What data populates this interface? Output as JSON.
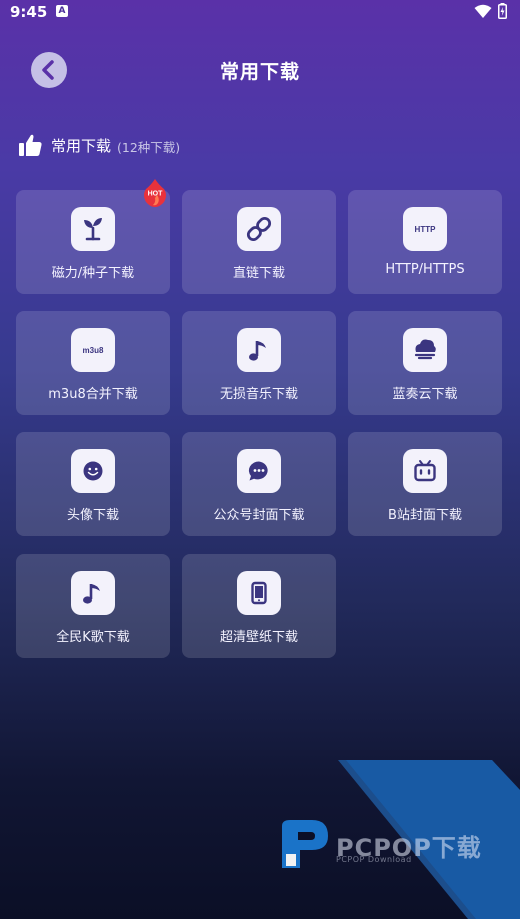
{
  "status_bar": {
    "time": "9:45",
    "notification": "A"
  },
  "header": {
    "title": "常用下载"
  },
  "section": {
    "label": "常用下载",
    "count": "(12种下载)"
  },
  "items": [
    {
      "label": "磁力/种子下载",
      "icon": "sprout-icon",
      "badge": "HOT"
    },
    {
      "label": "直链下载",
      "icon": "link-icon"
    },
    {
      "label": "HTTP/HTTPS",
      "icon": "http-icon",
      "icon_text": "HTTP"
    },
    {
      "label": "m3u8合并下载",
      "icon": "m3u8-icon",
      "icon_text": "m3u8"
    },
    {
      "label": "无损音乐下载",
      "icon": "music-note-icon"
    },
    {
      "label": "蓝奏云下载",
      "icon": "cloud-icon"
    },
    {
      "label": "头像下载",
      "icon": "smiley-icon"
    },
    {
      "label": "公众号封面下载",
      "icon": "chat-bubble-icon"
    },
    {
      "label": "B站封面下载",
      "icon": "bilibili-tv-icon"
    },
    {
      "label": "全民K歌下载",
      "icon": "music-note-icon"
    },
    {
      "label": "超清壁纸下载",
      "icon": "phone-icon"
    }
  ],
  "watermark": {
    "text": "PCPOP下载",
    "sub": "PCPOP Download"
  },
  "colors": {
    "icon_fg": "#3b3580",
    "accent": "#5a31a8",
    "hot": "#e8323c"
  }
}
